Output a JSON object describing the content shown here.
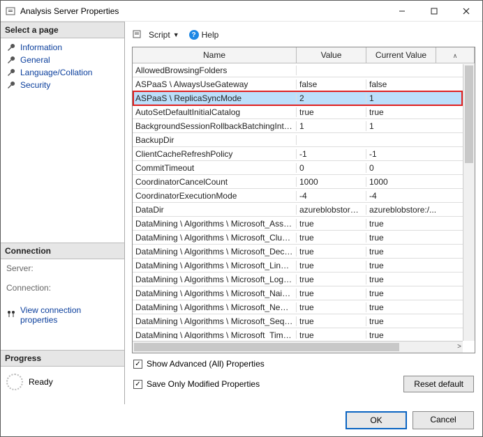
{
  "window": {
    "title": "Analysis Server Properties"
  },
  "left": {
    "select_header": "Select a page",
    "pages": [
      {
        "label": "Information"
      },
      {
        "label": "General"
      },
      {
        "label": "Language/Collation"
      },
      {
        "label": "Security"
      }
    ],
    "connection_header": "Connection",
    "server_label": "Server:",
    "connection_label": "Connection:",
    "view_conn": "View connection properties",
    "progress_header": "Progress",
    "progress_status": "Ready"
  },
  "toolbar": {
    "script_label": "Script",
    "help_label": "Help"
  },
  "grid": {
    "columns": {
      "name": "Name",
      "value": "Value",
      "current": "Current Value"
    },
    "rows": [
      {
        "name": "AllowedBrowsingFolders",
        "value": "",
        "current": ""
      },
      {
        "name": "ASPaaS \\ AlwaysUseGateway",
        "value": "false",
        "current": "false"
      },
      {
        "name": "ASPaaS \\ ReplicaSyncMode",
        "value": "2",
        "current": "1",
        "highlight": true
      },
      {
        "name": "AutoSetDefaultInitialCatalog",
        "value": "true",
        "current": "true"
      },
      {
        "name": "BackgroundSessionRollbackBatchingInterval",
        "value": "1",
        "current": "1"
      },
      {
        "name": "BackupDir",
        "value": "",
        "current": ""
      },
      {
        "name": "ClientCacheRefreshPolicy",
        "value": "-1",
        "current": "-1"
      },
      {
        "name": "CommitTimeout",
        "value": "0",
        "current": "0"
      },
      {
        "name": "CoordinatorCancelCount",
        "value": "1000",
        "current": "1000"
      },
      {
        "name": "CoordinatorExecutionMode",
        "value": "-4",
        "current": "-4"
      },
      {
        "name": "DataDir",
        "value": "azureblobstore:/...",
        "current": "azureblobstore:/..."
      },
      {
        "name": "DataMining \\ Algorithms \\ Microsoft_Associati...",
        "value": "true",
        "current": "true"
      },
      {
        "name": "DataMining \\ Algorithms \\ Microsoft_Clusterin...",
        "value": "true",
        "current": "true"
      },
      {
        "name": "DataMining \\ Algorithms \\ Microsoft_Decision...",
        "value": "true",
        "current": "true"
      },
      {
        "name": "DataMining \\ Algorithms \\ Microsoft_Linear_R...",
        "value": "true",
        "current": "true"
      },
      {
        "name": "DataMining \\ Algorithms \\ Microsoft_Logistic_...",
        "value": "true",
        "current": "true"
      },
      {
        "name": "DataMining \\ Algorithms \\ Microsoft_Naive_B...",
        "value": "true",
        "current": "true"
      },
      {
        "name": "DataMining \\ Algorithms \\ Microsoft_Neural_...",
        "value": "true",
        "current": "true"
      },
      {
        "name": "DataMining \\ Algorithms \\ Microsoft_Sequenc...",
        "value": "true",
        "current": "true"
      },
      {
        "name": "DataMining \\ Algorithms \\ Microsoft_Time_Se...",
        "value": "true",
        "current": "true"
      }
    ]
  },
  "options": {
    "show_advanced": "Show Advanced (All) Properties",
    "save_modified": "Save Only Modified Properties",
    "reset_default": "Reset default"
  },
  "footer": {
    "ok": "OK",
    "cancel": "Cancel"
  }
}
